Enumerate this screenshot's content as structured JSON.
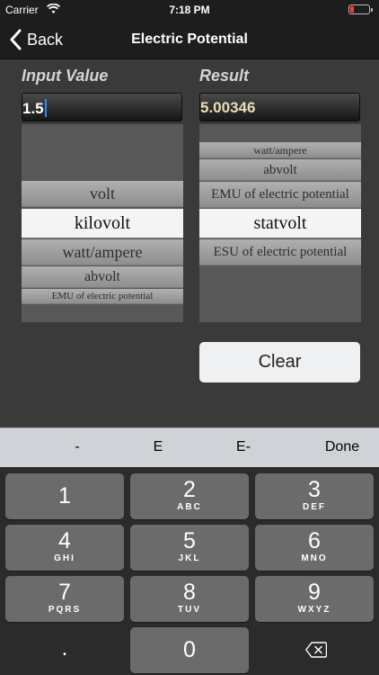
{
  "status_bar": {
    "carrier": "Carrier",
    "time": "7:18 PM"
  },
  "nav": {
    "back_label": "Back",
    "title": "Electric Potential"
  },
  "input": {
    "label": "Input Value",
    "value": "1.5"
  },
  "result": {
    "label": "Result",
    "value": "5.00346"
  },
  "left_picker": {
    "rows": [
      "volt",
      "kilovolt",
      "watt/ampere",
      "abvolt",
      "EMU of electric potential"
    ],
    "selected": "kilovolt"
  },
  "right_picker": {
    "rows": [
      "watt/ampere",
      "abvolt",
      "EMU of electric potential",
      "statvolt",
      "ESU of electric potential"
    ],
    "selected": "statvolt"
  },
  "clear_label": "Clear",
  "accessory": {
    "keys": [
      "-",
      "E",
      "E-"
    ],
    "done_label": "Done"
  },
  "keypad": {
    "keys": [
      {
        "digit": "1",
        "letters": ""
      },
      {
        "digit": "2",
        "letters": "ABC"
      },
      {
        "digit": "3",
        "letters": "DEF"
      },
      {
        "digit": "4",
        "letters": "GHI"
      },
      {
        "digit": "5",
        "letters": "JKL"
      },
      {
        "digit": "6",
        "letters": "MNO"
      },
      {
        "digit": "7",
        "letters": "PQRS"
      },
      {
        "digit": "8",
        "letters": "TUV"
      },
      {
        "digit": "9",
        "letters": "WXYZ"
      },
      {
        "digit": ".",
        "letters": ""
      },
      {
        "digit": "0",
        "letters": ""
      }
    ]
  },
  "colors": {
    "result_text": "#e9dfb6",
    "caret": "#2b8cff",
    "battery": "#ff3b30"
  },
  "icons": [
    "wifi-icon",
    "battery-icon",
    "chevron-left-icon",
    "backspace-icon"
  ]
}
